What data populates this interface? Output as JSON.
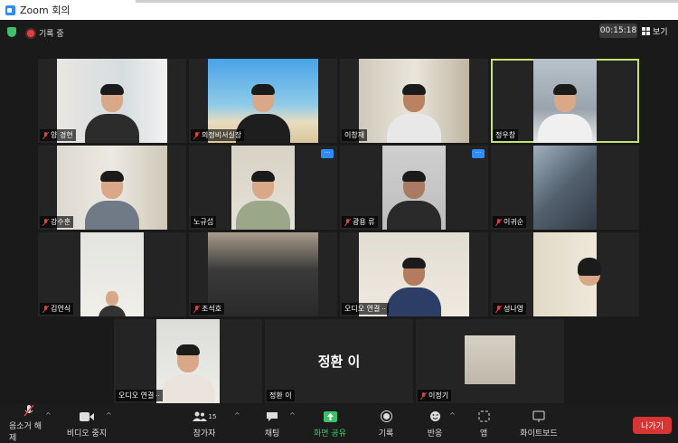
{
  "window": {
    "title": "Zoom 회의"
  },
  "header": {
    "recording_label": "기록 중",
    "timer": "00:15:18",
    "view_label": "보기"
  },
  "participants": [
    {
      "name": "양 경현"
    },
    {
      "name": "의정비서실장"
    },
    {
      "name": "이창재"
    },
    {
      "name": "정우창"
    },
    {
      "name": "강수훈"
    },
    {
      "name": "노규섭"
    },
    {
      "name": "광용 류"
    },
    {
      "name": "이귀순"
    },
    {
      "name": "김연식"
    },
    {
      "name": "조석호"
    },
    {
      "name": "오디오 연결"
    },
    {
      "name": "성나영"
    },
    {
      "name": "오디오 연결"
    },
    {
      "name": "정환 이",
      "center_name": "정환 이"
    },
    {
      "name": "이정기"
    }
  ],
  "toolbar": {
    "unmute": "음소거 해제",
    "stop_video": "비디오 중지",
    "participants": "참가자",
    "participants_count": "15",
    "chat": "채팅",
    "share": "화면 공유",
    "record": "기록",
    "reactions": "반응",
    "apps": "앱",
    "whiteboard": "화이트보드",
    "leave": "나가기"
  },
  "colors": {
    "accent": "#2d8cff",
    "share_green": "#3ec06a",
    "leave_red": "#d73434",
    "active_speaker": "#c8e36a"
  }
}
